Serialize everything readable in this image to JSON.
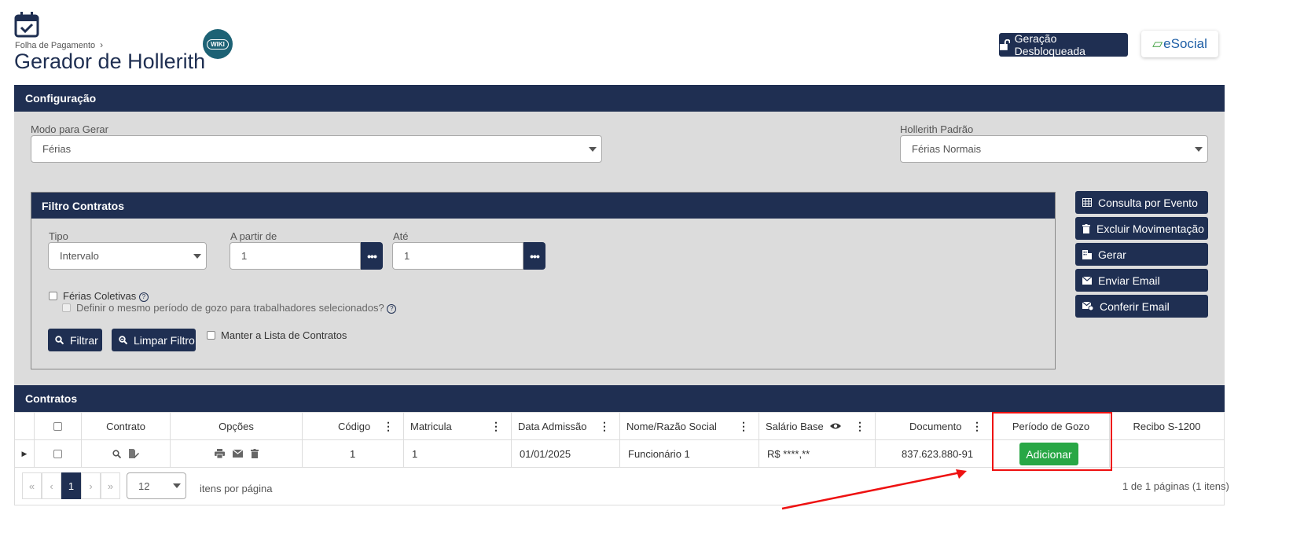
{
  "header": {
    "breadcrumb": "Folha de Pagamento",
    "title": "Gerador de Hollerith",
    "wiki_label": "WIKI",
    "unlocked_button": "Geração Desbloqueada",
    "esocial_label": "eSocial"
  },
  "config": {
    "title": "Configuração",
    "mode_label": "Modo para Gerar",
    "mode_value": "Férias",
    "hollerith_label": "Hollerith Padrão",
    "hollerith_value": "Férias Normais"
  },
  "filter": {
    "title": "Filtro Contratos",
    "tipo_label": "Tipo",
    "tipo_value": "Intervalo",
    "from_label": "A partir de",
    "from_value": "1",
    "to_label": "Até",
    "to_value": "1",
    "collective_label": "Férias Coletivas",
    "same_period_label": "Definir o mesmo período de gozo para trabalhadores selecionados?",
    "filter_button": "Filtrar",
    "clear_button": "Limpar Filtro",
    "keep_list_label": "Manter a Lista de Contratos"
  },
  "side_actions": {
    "consulta": "Consulta por Evento",
    "excluir": "Excluir Movimentação",
    "gerar": "Gerar",
    "enviar": "Enviar Email",
    "conferir": "Conferir Email"
  },
  "contracts": {
    "title": "Contratos",
    "columns": {
      "contrato": "Contrato",
      "opcoes": "Opções",
      "codigo": "Código",
      "matricula": "Matricula",
      "admissao": "Data Admissão",
      "nome": "Nome/Razão Social",
      "salario": "Salário Base",
      "documento": "Documento",
      "periodo": "Período de Gozo",
      "recibo": "Recibo S-1200"
    },
    "row": {
      "codigo": "1",
      "matricula": "1",
      "admissao": "01/01/2025",
      "nome": "Funcionário 1",
      "salario": "R$ ****,**",
      "documento": "837.623.880-91",
      "add_button": "Adicionar"
    },
    "pager": {
      "first": "«",
      "prev": "‹",
      "page": "1",
      "next": "›",
      "last": "»",
      "page_size": "12",
      "per_page_label": "itens por página",
      "summary": "1 de 1 páginas (1 itens)"
    }
  },
  "colors": {
    "navy": "#1f2f52",
    "panel": "#dcdcdc",
    "success": "#28a745",
    "highlight": "#ee1111"
  }
}
